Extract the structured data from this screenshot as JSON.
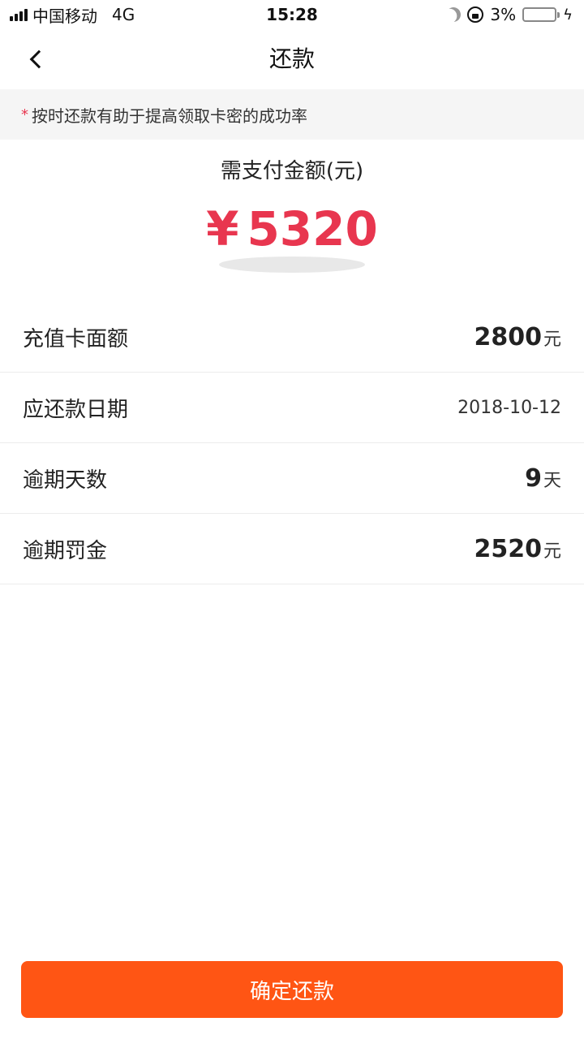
{
  "status_bar": {
    "carrier": "中国移动",
    "network": "4G",
    "time": "15:28",
    "battery": "3%",
    "battery_level": 0.03,
    "battery_color": "#e53935"
  },
  "nav": {
    "title": "还款",
    "back_icon": "chevron-left-icon"
  },
  "notice": {
    "asterisk": "*",
    "text": "按时还款有助于提高领取卡密的成功率"
  },
  "amount": {
    "label": "需支付金额(元)",
    "currency": "¥",
    "value": "5320",
    "color": "#e8364f"
  },
  "details": {
    "face_value": {
      "label": "充值卡面额",
      "value": "2800",
      "unit": "元"
    },
    "due_date": {
      "label": "应还款日期",
      "value": "2018-10-12"
    },
    "overdue_days": {
      "label": "逾期天数",
      "value": "9",
      "unit": "天"
    },
    "penalty": {
      "label": "逾期罚金",
      "value": "2520",
      "unit": "元"
    }
  },
  "confirm": {
    "label": "确定还款",
    "color": "#ff5514"
  }
}
